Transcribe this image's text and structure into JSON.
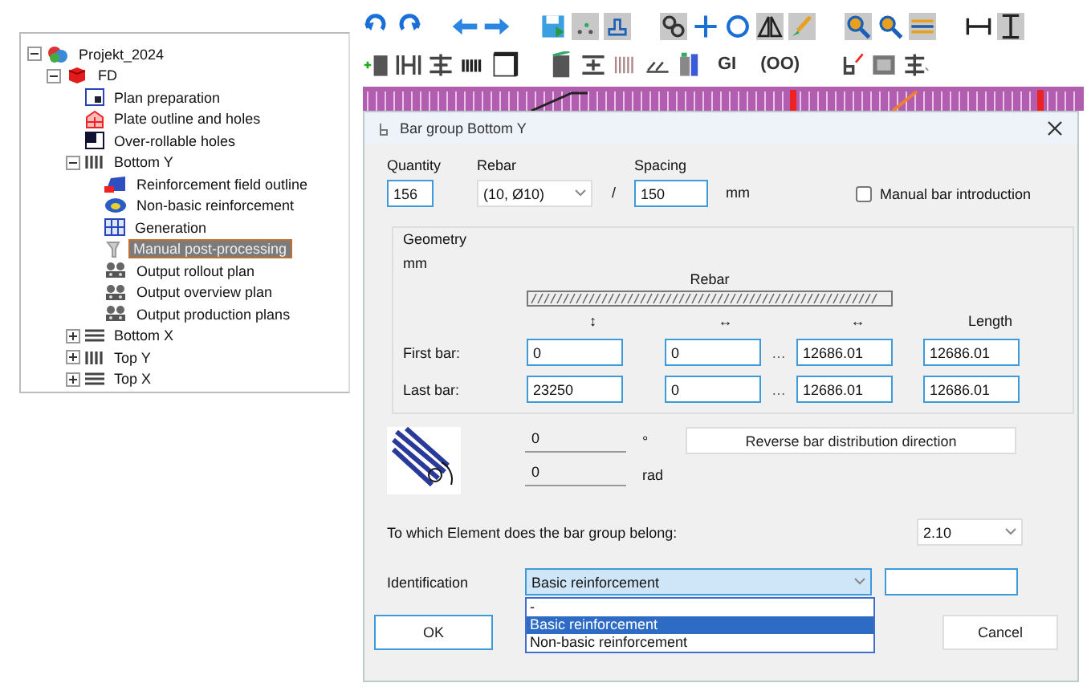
{
  "project_tree": [
    {
      "label": "Projekt_2024",
      "kind": "project",
      "selected": false,
      "expanded": true,
      "children": [
        {
          "label": "FD",
          "kind": "model",
          "selected": false,
          "expanded": true,
          "children": [
            {
              "label": "Plan preparation",
              "kind": "plan",
              "selected": false
            },
            {
              "label": "Plate outline and holes",
              "kind": "outline",
              "selected": false
            },
            {
              "label": "Over-rollable holes",
              "kind": "holes",
              "selected": false
            },
            {
              "label": "Bottom Y",
              "kind": "bars_vertical",
              "selected": false,
              "expanded": true,
              "children": [
                {
                  "label": "Reinforcement field outline",
                  "kind": "field",
                  "selected": false
                },
                {
                  "label": "Non-basic reinforcement",
                  "kind": "nonbasic",
                  "selected": false
                },
                {
                  "label": "Generation",
                  "kind": "grid",
                  "selected": false
                },
                {
                  "label": "Manual post-processing",
                  "kind": "manual",
                  "selected": true
                },
                {
                  "label": "Output rollout plan",
                  "kind": "output",
                  "selected": false
                },
                {
                  "label": "Output overview plan",
                  "kind": "output",
                  "selected": false
                },
                {
                  "label": "Output production plans",
                  "kind": "output",
                  "selected": false
                }
              ]
            },
            {
              "label": "Bottom X",
              "kind": "bars_horizontal",
              "selected": false,
              "expanded": false
            },
            {
              "label": "Top Y",
              "kind": "bars_vertical",
              "selected": false,
              "expanded": false
            },
            {
              "label": "Top X",
              "kind": "bars_horizontal",
              "selected": false,
              "expanded": false
            }
          ]
        }
      ]
    }
  ],
  "toolbar_texts": [
    "GI",
    "(OO)"
  ],
  "dialog": {
    "title": "Bar group Bottom Y",
    "quantity": {
      "label": "Quantity",
      "value": "156"
    },
    "rebar": {
      "label": "Rebar",
      "value": "(10, Ø10)"
    },
    "divider": "/",
    "spacing": {
      "label": "Spacing",
      "value": "150",
      "unit": "mm"
    },
    "manual_bar_introduction": {
      "label": "Manual bar introduction",
      "checked": false
    },
    "geometry": {
      "title": "Geometry",
      "unit": "mm",
      "rebar_label": "Rebar",
      "columns": [
        "↕",
        "↔",
        "↔",
        "Length"
      ],
      "rows": [
        {
          "label": "First bar:",
          "values": [
            "0",
            "0",
            "12686.01",
            "12686.01"
          ],
          "separator": "…"
        },
        {
          "label": "Last bar:",
          "values": [
            "23250",
            "0",
            "12686.01",
            "12686.01"
          ],
          "separator": "…"
        }
      ]
    },
    "angle": {
      "degrees": "0",
      "degree_unit": "°",
      "radians": "0",
      "radian_unit": "rad"
    },
    "reverse_button": "Reverse bar distribution direction",
    "element": {
      "label": "To which Element does the bar group belong:",
      "value": "2.10"
    },
    "identification": {
      "label": "Identification",
      "value": "Basic reinforcement",
      "expanded": true,
      "options": [
        {
          "label": "-",
          "selected": false
        },
        {
          "label": "Basic reinforcement",
          "selected": true
        },
        {
          "label": "Non-basic reinforcement",
          "selected": false
        }
      ]
    },
    "buttons": {
      "ok": "OK",
      "cancel": "Cancel"
    }
  }
}
